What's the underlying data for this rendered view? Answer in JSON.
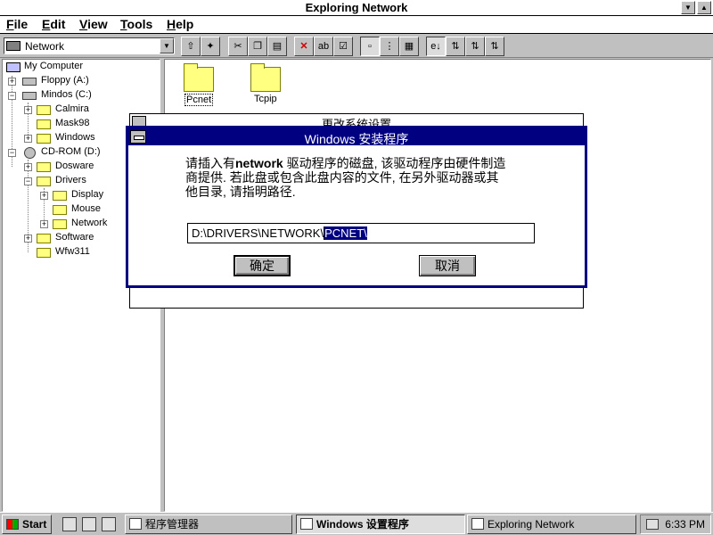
{
  "window": {
    "title": "Exploring Network"
  },
  "menu": [
    "File",
    "Edit",
    "View",
    "Tools",
    "Help"
  ],
  "toolbar": {
    "location": "Network",
    "buttons": [
      "up-folder",
      "map-drive",
      "disconnect-drive",
      "cut",
      "copy",
      "paste",
      "delete",
      "rename",
      "properties",
      "large-icons",
      "small-icons",
      "list",
      "details",
      "sort-name",
      "sort-type",
      "sort-size",
      "sort-date"
    ]
  },
  "tree": {
    "items": [
      {
        "label": "My Computer",
        "icon": "computer-icon"
      },
      {
        "label": "Floppy (A:)",
        "icon": "floppy-drive-icon"
      },
      {
        "label": "Mindos (C:)",
        "icon": "hard-drive-icon"
      },
      {
        "label": "Calmira",
        "icon": "folder-icon"
      },
      {
        "label": "Mask98",
        "icon": "folder-icon"
      },
      {
        "label": "Windows",
        "icon": "folder-icon"
      },
      {
        "label": "CD-ROM (D:)",
        "icon": "cdrom-icon"
      },
      {
        "label": "Dosware",
        "icon": "folder-icon"
      },
      {
        "label": "Drivers",
        "icon": "folder-icon"
      },
      {
        "label": "Display",
        "icon": "folder-icon"
      },
      {
        "label": "Mouse",
        "icon": "folder-icon"
      },
      {
        "label": "Network",
        "icon": "folder-icon"
      },
      {
        "label": "Software",
        "icon": "folder-icon"
      },
      {
        "label": "Wfw311",
        "icon": "folder-icon"
      }
    ]
  },
  "content": {
    "items": [
      {
        "label": "Pcnet"
      },
      {
        "label": "Tcpip"
      }
    ]
  },
  "background_window": {
    "title": "更改系统设置"
  },
  "dialog": {
    "title": "Windows 安装程序",
    "message_line1_pre": "请插入有",
    "message_line1_bold": "network",
    "message_line1_post": " 驱动程序的磁盘, 该驱动程序由硬件制造",
    "message_line2": "商提供. 若此盘或包含此盘内容的文件, 在另外驱动器或其",
    "message_line3": "他目录, 请指明路径.",
    "path_prefix": "D:\\DRIVERS\\NETWORK\\",
    "path_selected": "PCNET\\",
    "ok_label": "确定",
    "cancel_label": "取消"
  },
  "taskbar": {
    "start_label": "Start",
    "tasks": [
      {
        "label": "程序管理器",
        "active": false
      },
      {
        "label": "Windows 设置程序",
        "active": true
      },
      {
        "label": "Exploring Network",
        "active": false
      }
    ],
    "clock": "6:33 PM"
  }
}
